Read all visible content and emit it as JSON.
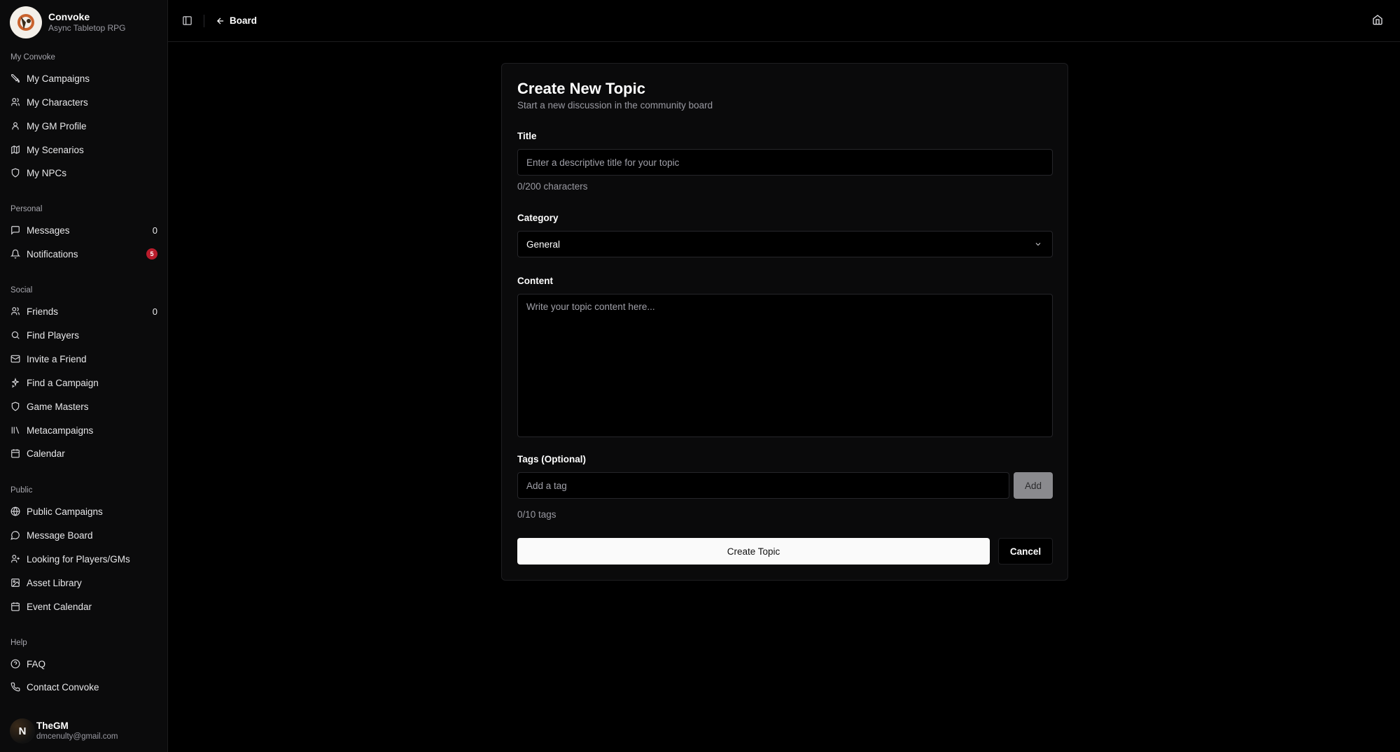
{
  "brand": {
    "name": "Convoke",
    "subtitle": "Async Tabletop RPG"
  },
  "sidebar": {
    "groups": [
      {
        "label": "My Convoke",
        "items": [
          {
            "label": "My Campaigns",
            "icon": "crossed-swords-icon"
          },
          {
            "label": "My Characters",
            "icon": "users-icon"
          },
          {
            "label": "My GM Profile",
            "icon": "user-icon"
          },
          {
            "label": "My Scenarios",
            "icon": "map-icon"
          },
          {
            "label": "My NPCs",
            "icon": "shield-icon"
          }
        ]
      },
      {
        "label": "Personal",
        "items": [
          {
            "label": "Messages",
            "icon": "message-icon",
            "count": "0"
          },
          {
            "label": "Notifications",
            "icon": "bell-icon",
            "badge": "5"
          }
        ]
      },
      {
        "label": "Social",
        "items": [
          {
            "label": "Friends",
            "icon": "users-icon",
            "count": "0"
          },
          {
            "label": "Find Players",
            "icon": "search-icon"
          },
          {
            "label": "Invite a Friend",
            "icon": "mail-icon"
          },
          {
            "label": "Find a Campaign",
            "icon": "sparkles-icon"
          },
          {
            "label": "Game Masters",
            "icon": "shield-icon"
          },
          {
            "label": "Metacampaigns",
            "icon": "library-icon"
          },
          {
            "label": "Calendar",
            "icon": "calendar-icon"
          }
        ]
      },
      {
        "label": "Public",
        "items": [
          {
            "label": "Public Campaigns",
            "icon": "globe-icon"
          },
          {
            "label": "Message Board",
            "icon": "message-icon"
          },
          {
            "label": "Looking for Players/GMs",
            "icon": "user-plus-icon"
          },
          {
            "label": "Asset Library",
            "icon": "image-icon"
          },
          {
            "label": "Event Calendar",
            "icon": "calendar-icon"
          }
        ]
      },
      {
        "label": "Help",
        "items": [
          {
            "label": "FAQ",
            "icon": "help-circle-icon"
          },
          {
            "label": "Contact Convoke",
            "icon": "phone-icon"
          }
        ]
      }
    ]
  },
  "user": {
    "initial": "N",
    "name": "TheGM",
    "email": "dmcenulty@gmail.com"
  },
  "topbar": {
    "back_label": "Board"
  },
  "form": {
    "title": "Create New Topic",
    "subtitle": "Start a new discussion in the community board",
    "title_label": "Title",
    "title_placeholder": "Enter a descriptive title for your topic",
    "title_counter": "0/200 characters",
    "category_label": "Category",
    "category_value": "General",
    "content_label": "Content",
    "content_placeholder": "Write your topic content here...",
    "tags_label": "Tags (Optional)",
    "tags_placeholder": "Add a tag",
    "add_label": "Add",
    "tags_counter": "0/10 tags",
    "submit_label": "Create Topic",
    "cancel_label": "Cancel"
  },
  "colors": {
    "background": "#000000",
    "sidebar": "#0b0b0c",
    "badge": "#b91c2c",
    "primary_button": "#fafafa"
  }
}
